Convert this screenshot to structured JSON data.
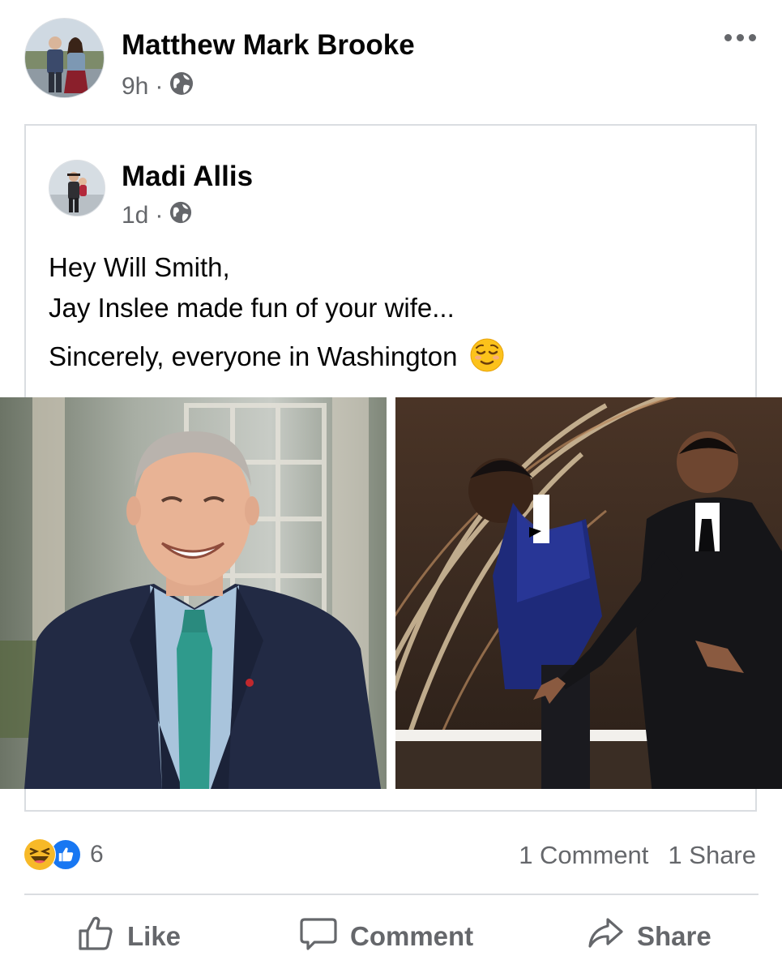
{
  "post": {
    "author": "Matthew Mark Brooke",
    "time": "9h",
    "separator": "·",
    "privacy_icon": "globe-icon",
    "more_icon": "more-options-icon"
  },
  "shared": {
    "author": "Madi Allis",
    "time": "1d",
    "separator": "·",
    "privacy_icon": "globe-icon",
    "lines": [
      "Hey Will Smith,",
      "Jay Inslee made fun of your wife...",
      "Sincerely, everyone in Washington"
    ],
    "emoji": "relieved-face-emoji"
  },
  "reactions": {
    "icons": [
      "haha-icon",
      "like-icon"
    ],
    "count": "6",
    "comments": "1 Comment",
    "shares": "1 Share"
  },
  "actions": {
    "like": "Like",
    "comment": "Comment",
    "share": "Share"
  },
  "colors": {
    "like_blue": "#1877f2",
    "haha_yellow": "#f7b928",
    "meta_gray": "#65676b",
    "border": "#dadde1"
  }
}
